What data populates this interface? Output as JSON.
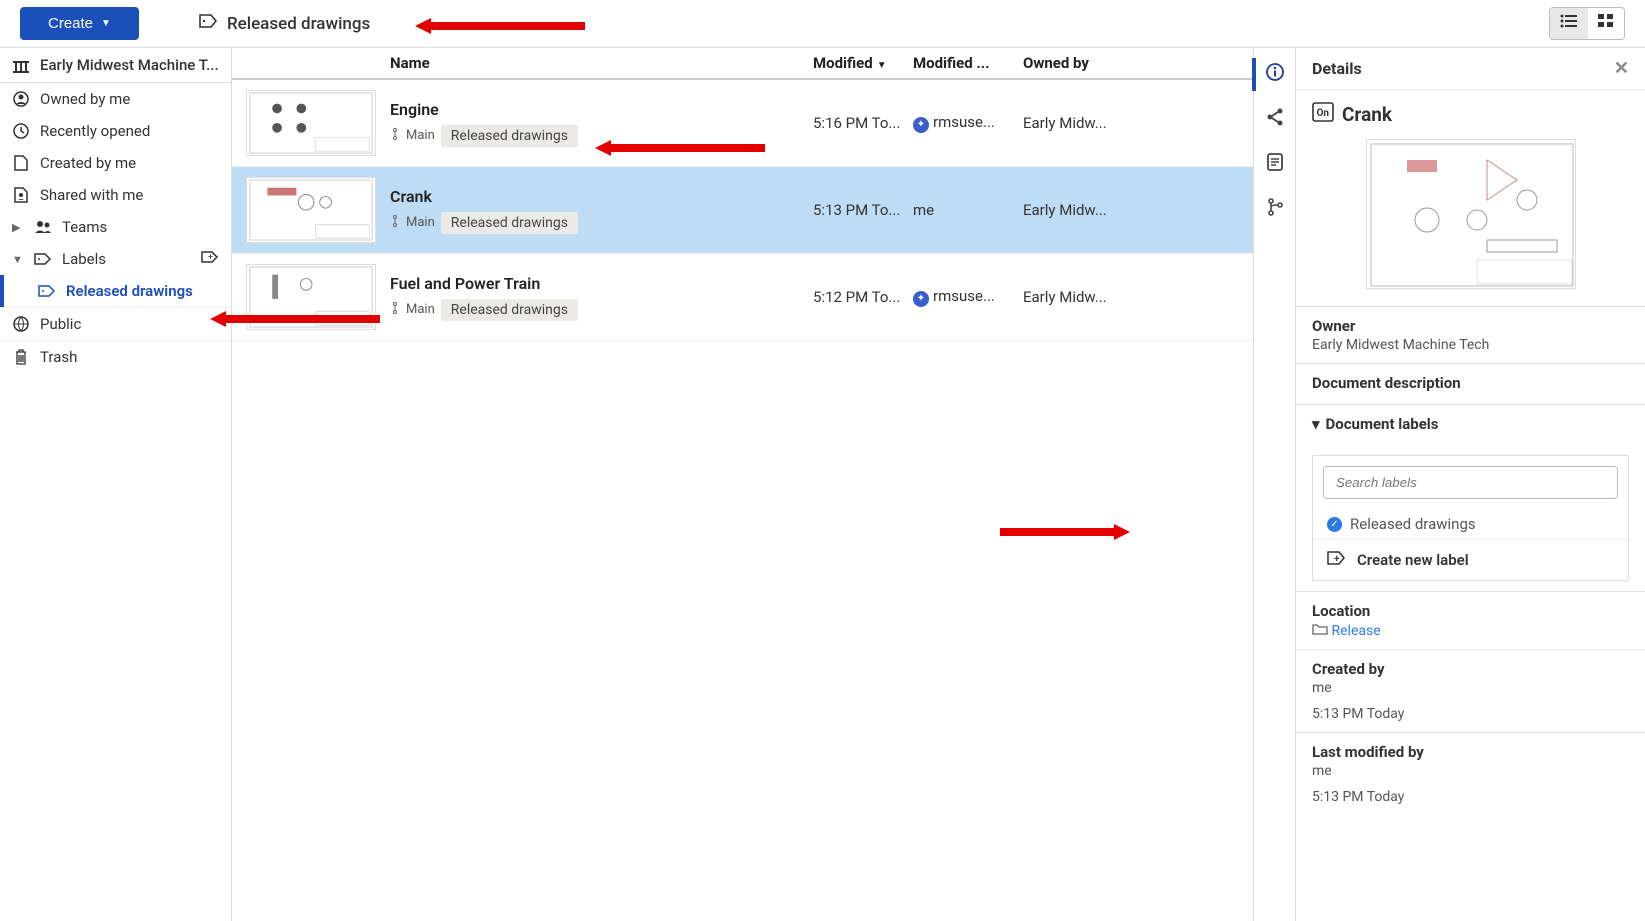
{
  "topbar": {
    "create_label": "Create",
    "breadcrumb": "Released drawings"
  },
  "sidebar": {
    "team_root": "Early Midwest Machine T...",
    "filters": {
      "owned_by_me": "Owned by me",
      "recently_opened": "Recently opened",
      "created_by_me": "Created by me",
      "shared_with_me": "Shared with me",
      "teams": "Teams",
      "labels": "Labels",
      "released_drawings": "Released drawings",
      "public": "Public",
      "trash": "Trash"
    }
  },
  "columns": {
    "name": "Name",
    "modified": "Modified",
    "modified_by": "Modified ...",
    "owned_by": "Owned by"
  },
  "rows": [
    {
      "name": "Engine",
      "modified": "5:16 PM To...",
      "modified_by": "rmsuse...",
      "owned_by": "Early Midw...",
      "branch": "Main",
      "label": "Released drawings",
      "user_icon": true
    },
    {
      "name": "Crank",
      "modified": "5:13 PM To...",
      "modified_by": "me",
      "owned_by": "Early Midw...",
      "branch": "Main",
      "label": "Released drawings",
      "user_icon": false
    },
    {
      "name": "Fuel and Power Train",
      "modified": "5:12 PM To...",
      "modified_by": "rmsuse...",
      "owned_by": "Early Midw...",
      "branch": "Main",
      "label": "Released drawings",
      "user_icon": true
    }
  ],
  "details": {
    "header": "Details",
    "doc_title": "Crank",
    "owner_label": "Owner",
    "owner_value": "Early Midwest Machine Tech",
    "description_label": "Document description",
    "labels_header": "Document labels",
    "search_placeholder": "Search labels",
    "label_option": "Released drawings",
    "create_new_label": "Create new label",
    "location_label": "Location",
    "location_value": "Release",
    "created_by_label": "Created by",
    "created_by_value": "me",
    "created_time": "5:13 PM Today",
    "last_mod_label": "Last modified by",
    "last_mod_value": "me",
    "last_mod_time": "5:13 PM Today"
  }
}
